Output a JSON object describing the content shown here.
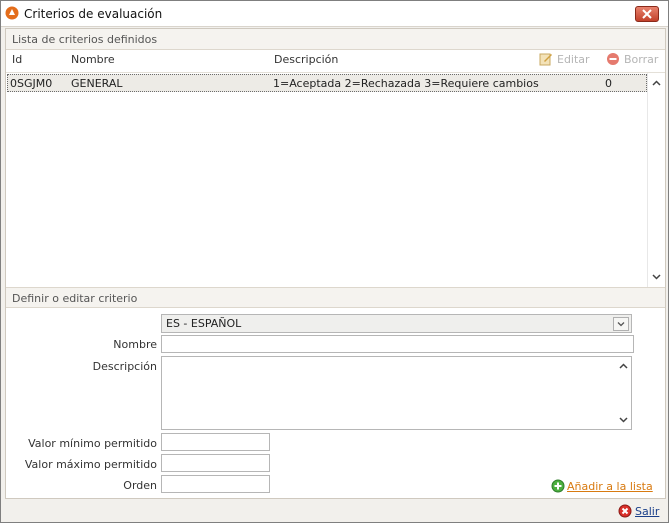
{
  "window": {
    "title": "Criterios de evaluación"
  },
  "list_section": {
    "header": "Lista de criterios definidos",
    "columns": {
      "id": "Id",
      "nombre": "Nombre",
      "descripcion": "Descripción"
    },
    "toolbar": {
      "edit_label": "Editar",
      "delete_label": "Borrar"
    },
    "rows": [
      {
        "id": "0SGJM0",
        "nombre": "GENERAL",
        "descripcion": "1=Aceptada 2=Rechazada 3=Requiere cambios",
        "valor": "0"
      }
    ]
  },
  "form_section": {
    "header": "Definir o editar criterio",
    "language_selected": "ES - ESPAÑOL",
    "labels": {
      "nombre": "Nombre",
      "descripcion": "Descripción",
      "min": "Valor mínimo permitido",
      "max": "Valor máximo permitido",
      "orden": "Orden"
    },
    "values": {
      "nombre": "",
      "descripcion": "",
      "min": "",
      "max": "",
      "orden": ""
    },
    "add_label": "Añadir a la lista"
  },
  "footer": {
    "exit_label": "Salir"
  },
  "colors": {
    "accent_orange": "#d87a10",
    "link_blue": "#1a3f8a",
    "close_red": "#c2412b",
    "add_green": "#3aa63a"
  }
}
